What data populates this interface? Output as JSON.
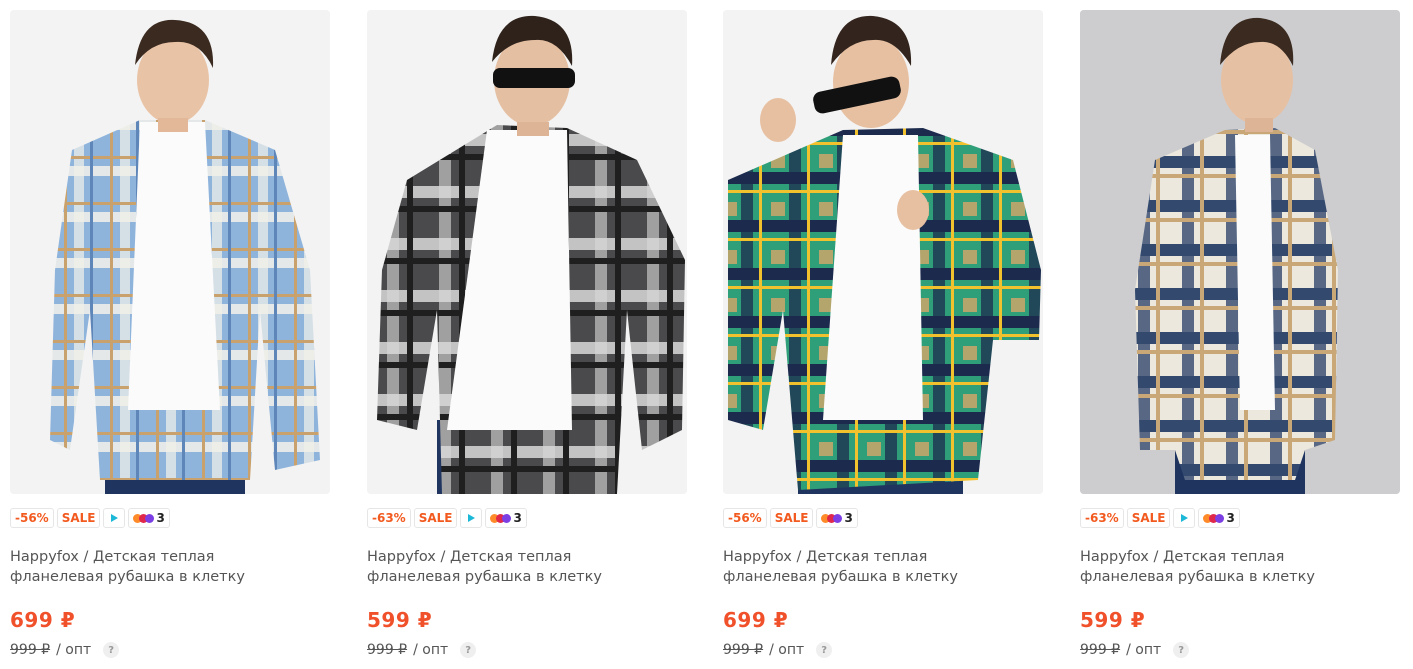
{
  "products": [
    {
      "discount": "-56%",
      "sale": "SALE",
      "has_video": true,
      "loyalty_count": "3",
      "title_line1": "Happyfox / Детская теплая",
      "title_line2": "фланелевая рубашка в клетку",
      "price": "699 ₽",
      "old_price": "999 ₽",
      "wholesale": "/ опт",
      "help": "?",
      "colors": {
        "base": "#8fb4dc",
        "stripe": "#c9a16c",
        "accent": "#f3f1ea",
        "photo_bg": "#f3f3f3"
      }
    },
    {
      "discount": "-63%",
      "sale": "SALE",
      "has_video": true,
      "loyalty_count": "3",
      "title_line1": "Happyfox / Детская теплая",
      "title_line2": "фланелевая рубашка в клетку",
      "price": "599 ₽",
      "old_price": "999 ₽",
      "wholesale": "/ опт",
      "help": "?",
      "colors": {
        "base": "#4a4a4c",
        "stripe": "#1f1f20",
        "accent": "#d8d8d8",
        "photo_bg": "#f3f3f3"
      }
    },
    {
      "discount": "-56%",
      "sale": "SALE",
      "has_video": false,
      "loyalty_count": "3",
      "title_line1": "Happyfox / Детская теплая",
      "title_line2": "фланелевая рубашка в клетку",
      "price": "699 ₽",
      "old_price": "999 ₽",
      "wholesale": "/ опт",
      "help": "?",
      "colors": {
        "base": "#2f9f79",
        "stripe": "#1c2b4d",
        "accent": "#d6a66a",
        "photo_bg": "#f3f3f3"
      }
    },
    {
      "discount": "-63%",
      "sale": "SALE",
      "has_video": true,
      "loyalty_count": "3",
      "title_line1": "Happyfox / Детская теплая",
      "title_line2": "фланелевая рубашка в клетку",
      "price": "599 ₽",
      "old_price": "999 ₽",
      "wholesale": "/ опт",
      "help": "?",
      "colors": {
        "base": "#ece8dd",
        "stripe": "#33496e",
        "accent": "#c9a777",
        "photo_bg": "#cdcdcf"
      }
    }
  ],
  "theme": {
    "sale_color": "#f25a1f",
    "price_color": "#f0502a",
    "play_color": "#1cb8d8",
    "coin_colors": [
      "#ff8a2a",
      "#e0284a",
      "#7b3fe4"
    ]
  }
}
